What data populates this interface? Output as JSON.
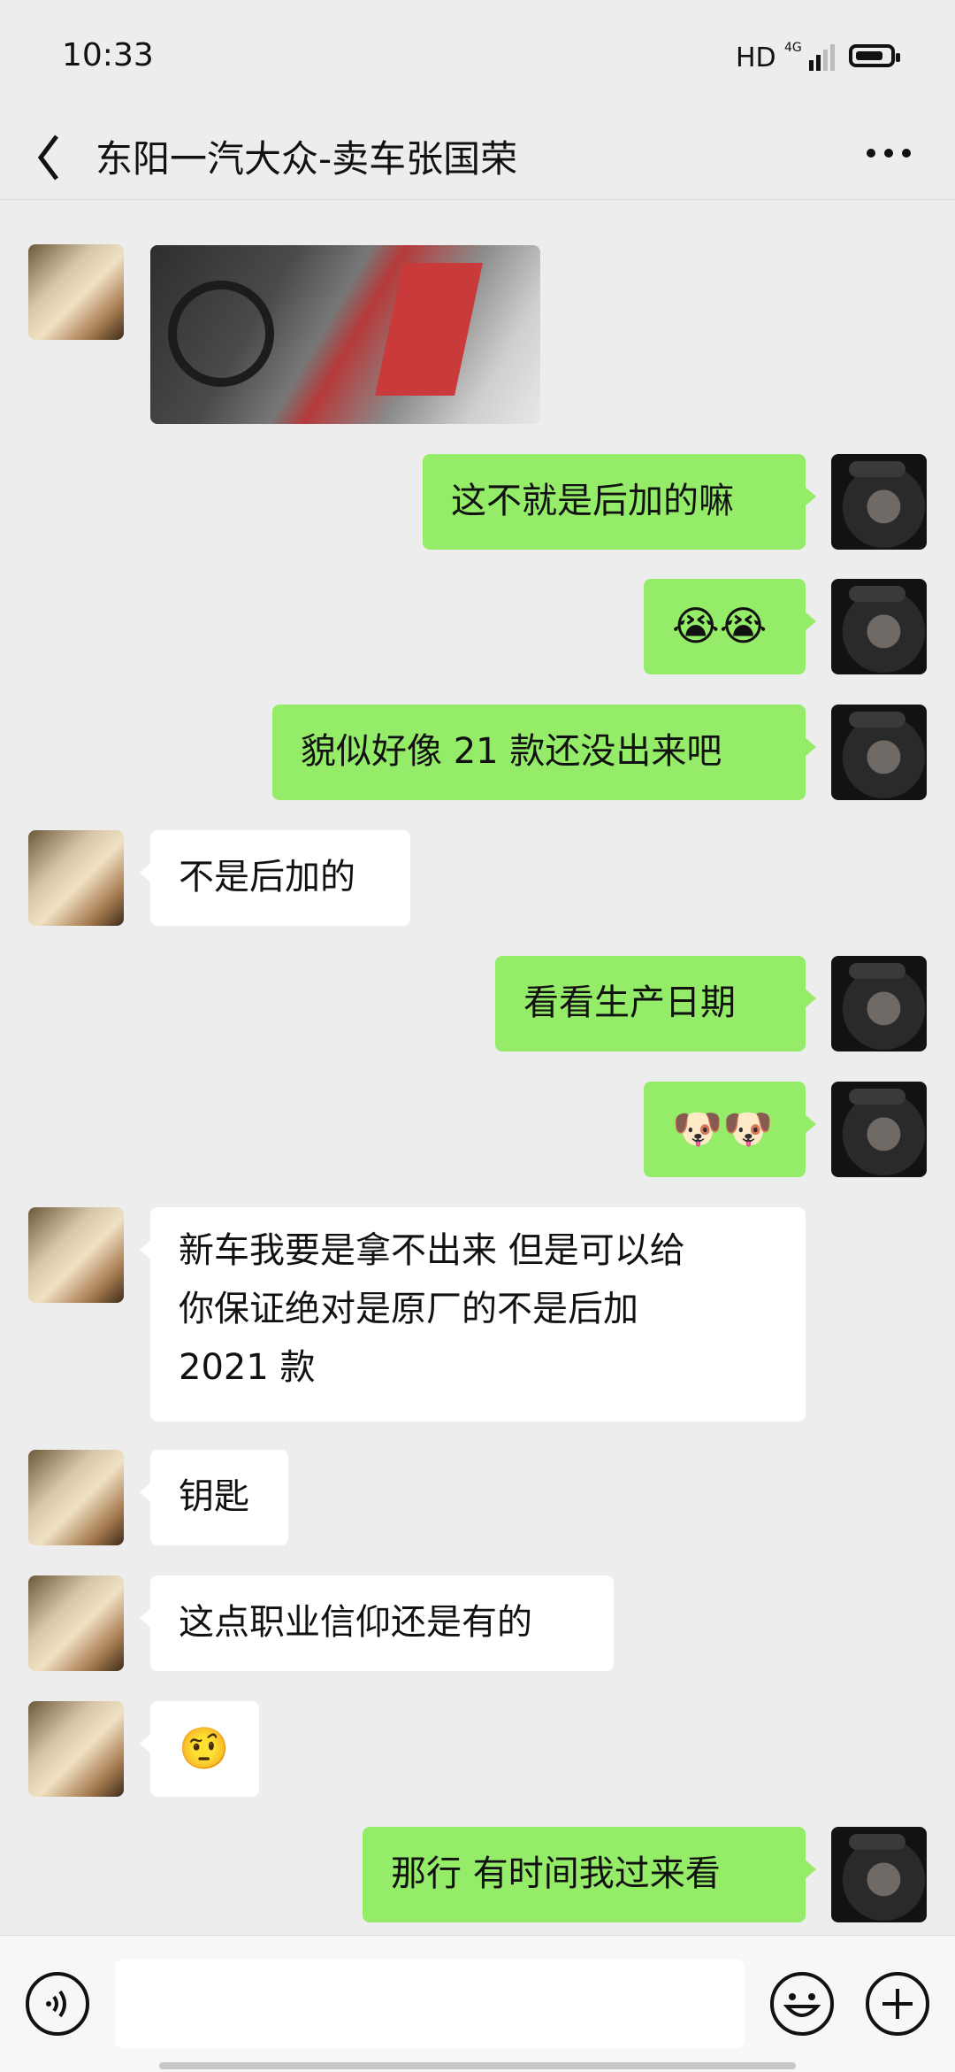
{
  "status": {
    "time": "10:33",
    "hd": "HD",
    "network": "4G"
  },
  "header": {
    "title": "东阳一汽大众-卖车张国荣"
  },
  "messages": [
    {
      "side": "left",
      "kind": "image"
    },
    {
      "side": "right",
      "text": "这不就是后加的嘛"
    },
    {
      "side": "right",
      "text": "😭😭"
    },
    {
      "side": "right",
      "text": "貌似好像 21 款还没出来吧"
    },
    {
      "side": "left",
      "text": "不是后加的"
    },
    {
      "side": "right",
      "text": "看看生产日期"
    },
    {
      "side": "right",
      "text": "🐶🐶"
    },
    {
      "side": "left",
      "lines": [
        "新车我要是拿不出来  但是可以给",
        "你保证绝对是原厂的不是后加",
        "2021 款"
      ]
    },
    {
      "side": "left",
      "text": "钥匙"
    },
    {
      "side": "left",
      "text": "这点职业信仰还是有的"
    },
    {
      "side": "left",
      "text": "🤨"
    },
    {
      "side": "right",
      "text": "那行 有时间我过来看"
    }
  ],
  "input": {
    "value": "",
    "placeholder": ""
  },
  "icons": {
    "back": "chevron-left-icon",
    "more": "more-dots-icon",
    "voice": "voice-icon",
    "emoji": "emoji-icon",
    "plus": "plus-icon"
  },
  "colors": {
    "background": "#EDEDED",
    "sent_bubble": "#95EC69",
    "received_bubble": "#FFFFFF"
  }
}
